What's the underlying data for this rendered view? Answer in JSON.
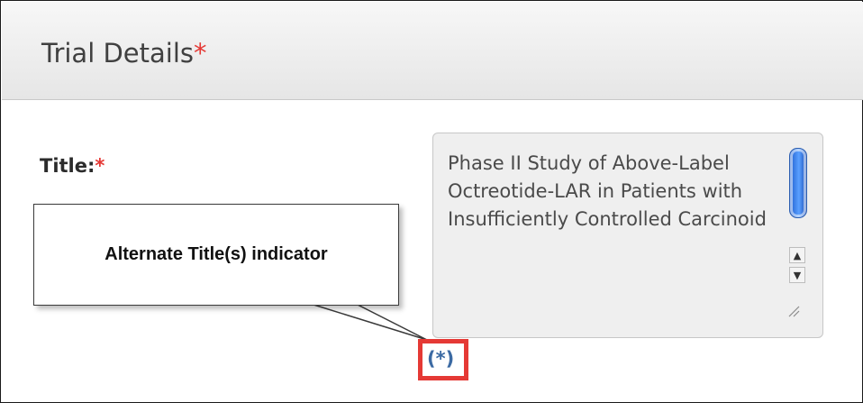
{
  "header": {
    "title": "Trial Details",
    "required_mark": "*"
  },
  "form": {
    "title_label": "Title:",
    "title_required_mark": "*",
    "title_value": "Phase II Study of Above-Label Octreotide-LAR in Patients with Insufficiently Controlled Carcinoid"
  },
  "callout": {
    "text": "Alternate Title(s) indicator"
  },
  "indicator": {
    "text": "(*)"
  },
  "scrollbar": {
    "up_arrow": "▲",
    "down_arrow": "▼"
  },
  "colors": {
    "required": "#e53935",
    "indicator_text": "#3b6aa3",
    "highlight_border": "#e53935"
  }
}
